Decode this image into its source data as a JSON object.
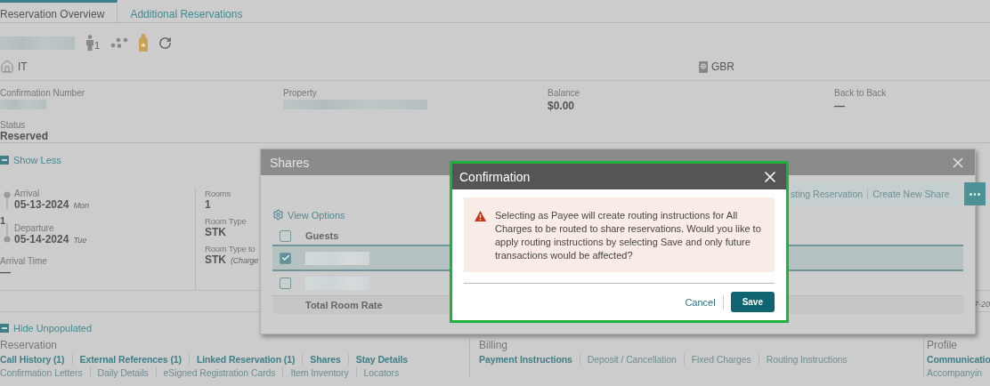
{
  "tabs": [
    {
      "label": "Reservation Overview",
      "selected": true
    },
    {
      "label": "Additional Reservations",
      "selected": false
    }
  ],
  "guest_header": {
    "adults": "1",
    "language": "IT",
    "nationality": "GBR"
  },
  "summary_fields": [
    {
      "label": "Confirmation Number",
      "kind": "blurred"
    },
    {
      "label": "Property",
      "kind": "blurred"
    },
    {
      "label": "Balance",
      "kind": "text",
      "value": "$0.00"
    },
    {
      "label": "Back to Back",
      "kind": "text",
      "value": "—"
    }
  ],
  "status": {
    "label": "Status",
    "value": "Reserved"
  },
  "show_less": {
    "label": "Show Less",
    "expanded": true
  },
  "stay": {
    "arrival": {
      "label": "Arrival",
      "date": "05-13-2024",
      "day": "Mon"
    },
    "nights": "1",
    "departure": {
      "label": "Departure",
      "date": "05-14-2024",
      "day": "Tue"
    },
    "arrival_time": {
      "label": "Arrival Time",
      "value": "—"
    },
    "rooms": {
      "label": "Rooms",
      "value": "1"
    },
    "room_type": {
      "label": "Room Type",
      "value": "STK"
    },
    "room_type_to_charge": {
      "label": "Room Type to",
      "value": "STK",
      "note": "(Charge"
    },
    "fragment": "7-20"
  },
  "hide_unpopulated": {
    "label": "Hide Unpopulated",
    "expanded": true
  },
  "sections": [
    {
      "title": "Reservation",
      "rows": [
        [
          {
            "label": "Call History (1)",
            "bold": true
          },
          {
            "label": "External References (1)",
            "bold": true
          },
          {
            "label": "Linked Reservation (1)",
            "bold": true
          },
          {
            "label": "Shares",
            "bold": true
          },
          {
            "label": "Stay Details",
            "bold": true
          }
        ],
        [
          {
            "label": "Confirmation Letters",
            "bold": false
          },
          {
            "label": "Daily Details",
            "bold": false
          },
          {
            "label": "eSigned Registration Cards",
            "bold": false
          },
          {
            "label": "Item Inventory",
            "bold": false
          },
          {
            "label": "Locators",
            "bold": false
          }
        ]
      ]
    },
    {
      "title": "Billing",
      "rows": [
        [
          {
            "label": "Payment Instructions",
            "bold": true
          },
          {
            "label": "Deposit / Cancellation",
            "bold": false
          },
          {
            "label": "Fixed Charges",
            "bold": false
          },
          {
            "label": "Routing Instructions",
            "bold": false
          }
        ]
      ]
    },
    {
      "title": "Profile",
      "rows": [
        [
          {
            "label": "Communicatio",
            "bold": true
          }
        ],
        [
          {
            "label": "Accompanyin",
            "bold": false
          }
        ]
      ]
    }
  ],
  "shares_dialog": {
    "title": "Shares",
    "actions": [
      "sting Reservation",
      "Create New Share"
    ],
    "view_options": "View Options",
    "header_checked": false,
    "column": "Guests",
    "rows": [
      {
        "checked": true,
        "selected": true
      },
      {
        "checked": false,
        "selected": false
      }
    ],
    "footer": "Total Room Rate"
  },
  "confirmation": {
    "title": "Confirmation",
    "message": "Selecting as Payee will create routing instructions for All Charges to be routed to share reservations. Would you like to apply routing instructions by selecting Save and only future transactions would be affected?",
    "buttons": [
      {
        "label": "Cancel",
        "kind": "link"
      },
      {
        "label": "Save",
        "kind": "primary"
      }
    ]
  }
}
